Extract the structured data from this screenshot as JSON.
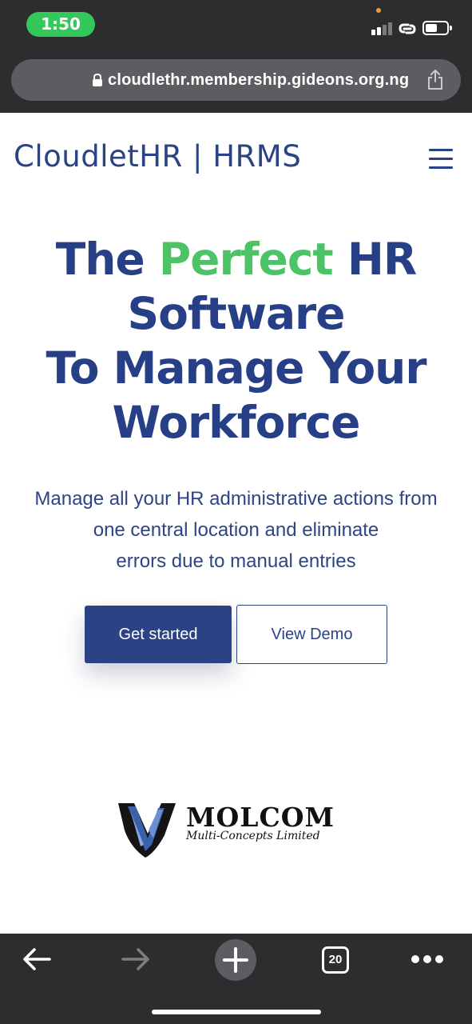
{
  "status_bar": {
    "time": "1:50",
    "icons": [
      "signal-icon",
      "link-icon",
      "battery-icon"
    ],
    "colors": {
      "time_pill": "#34c759",
      "recording_dot": "#f09a37"
    }
  },
  "browser": {
    "url": "cloudlethr.membership.gideons.org.ng",
    "tab_count": "20",
    "toolbar_icons": [
      "back-arrow-icon",
      "forward-arrow-icon",
      "new-tab-plus-icon",
      "tabs-icon",
      "more-dots-icon"
    ]
  },
  "site": {
    "brand": "CloudletHR | HRMS",
    "brand_color": "#2b4384",
    "hero": {
      "part1": "The ",
      "accent": "Perfect",
      "part2": " HR",
      "line2": "Software",
      "line3": "To Manage Your",
      "line4": "Workforce",
      "accent_color": "#4cc466"
    },
    "lead": {
      "line1": "Manage all your HR administrative actions from",
      "line2": "one central location and eliminate",
      "line3": "errors due to manual entries"
    },
    "buttons": {
      "primary": "Get started",
      "secondary": "View Demo"
    },
    "partner_logo": {
      "name": "MOLCOM",
      "subtitle": "Multi-Concepts Limited"
    }
  }
}
